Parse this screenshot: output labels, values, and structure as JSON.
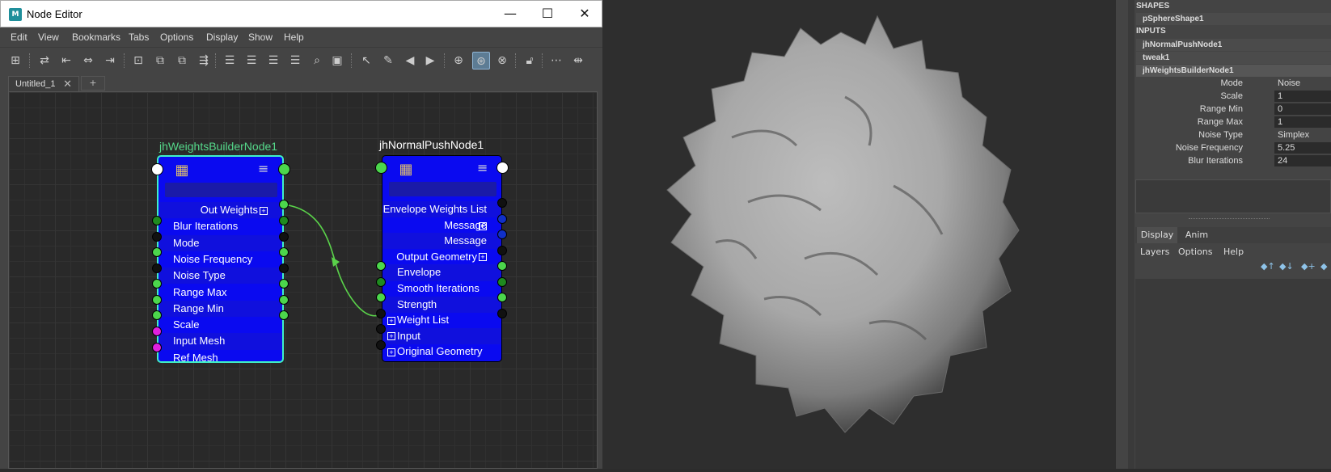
{
  "window": {
    "title": "Node Editor",
    "app_icon_text": "M",
    "min": "—",
    "max": "☐",
    "close": "✕"
  },
  "menu": [
    "Edit",
    "View",
    "Bookmarks",
    "Tabs",
    "Options",
    "Display",
    "Show",
    "Help"
  ],
  "tabs": {
    "active": "Untitled_1",
    "close": "✕",
    "add": "+"
  },
  "nodes": {
    "builder": {
      "title": "jhWeightsBuilderNode1",
      "title_color": "#55d88a",
      "outputs": [
        {
          "label": "Out Weights",
          "box": "+"
        }
      ],
      "rows": [
        "Blur Iterations",
        "Mode",
        "Noise Frequency",
        "Noise Type",
        "Range Max",
        "Range Min",
        "Scale",
        "Input Mesh",
        "Ref Mesh"
      ]
    },
    "push": {
      "title": "jhNormalPushNode1",
      "title_color": "#ffffff",
      "outputs": [
        {
          "label": "Envelope Weights List",
          "box": "+"
        },
        {
          "label": "Message",
          "box": ""
        },
        {
          "label": "Message",
          "box": ""
        },
        {
          "label": "Output Geometry",
          "box": "+"
        }
      ],
      "rows": [
        "Envelope",
        "Smooth Iterations",
        "Strength"
      ],
      "boxed_inputs": [
        "Weight List",
        "Input",
        "Original Geometry"
      ]
    }
  },
  "attribute_editor": {
    "shapes_header": "SHAPES",
    "shape": "pSphereShape1",
    "inputs_header": "INPUTS",
    "inputs": [
      "jhNormalPushNode1",
      "tweak1",
      "jhWeightsBuilderNode1"
    ],
    "attributes": [
      {
        "label": "Mode",
        "value": "Noise"
      },
      {
        "label": "Scale",
        "value": "1"
      },
      {
        "label": "Range Min",
        "value": "0"
      },
      {
        "label": "Range Max",
        "value": "1"
      },
      {
        "label": "Noise Type",
        "value": "Simplex"
      },
      {
        "label": "Noise Frequency",
        "value": "5.25"
      },
      {
        "label": "Blur Iterations",
        "value": "24"
      }
    ],
    "layer_tabs": [
      "Display",
      "Anim"
    ],
    "layer_menu": [
      "Layers",
      "Options",
      "Help"
    ]
  },
  "colors": {
    "node_body": "#0a0af0",
    "selected_outline": "#3ff0c8",
    "connection": "#5ad24a",
    "port_green": "#4cd64c",
    "port_dark_green": "#1f8a1f",
    "port_black": "#111111",
    "port_magenta": "#e020e0",
    "port_blue": "#1030c8"
  }
}
